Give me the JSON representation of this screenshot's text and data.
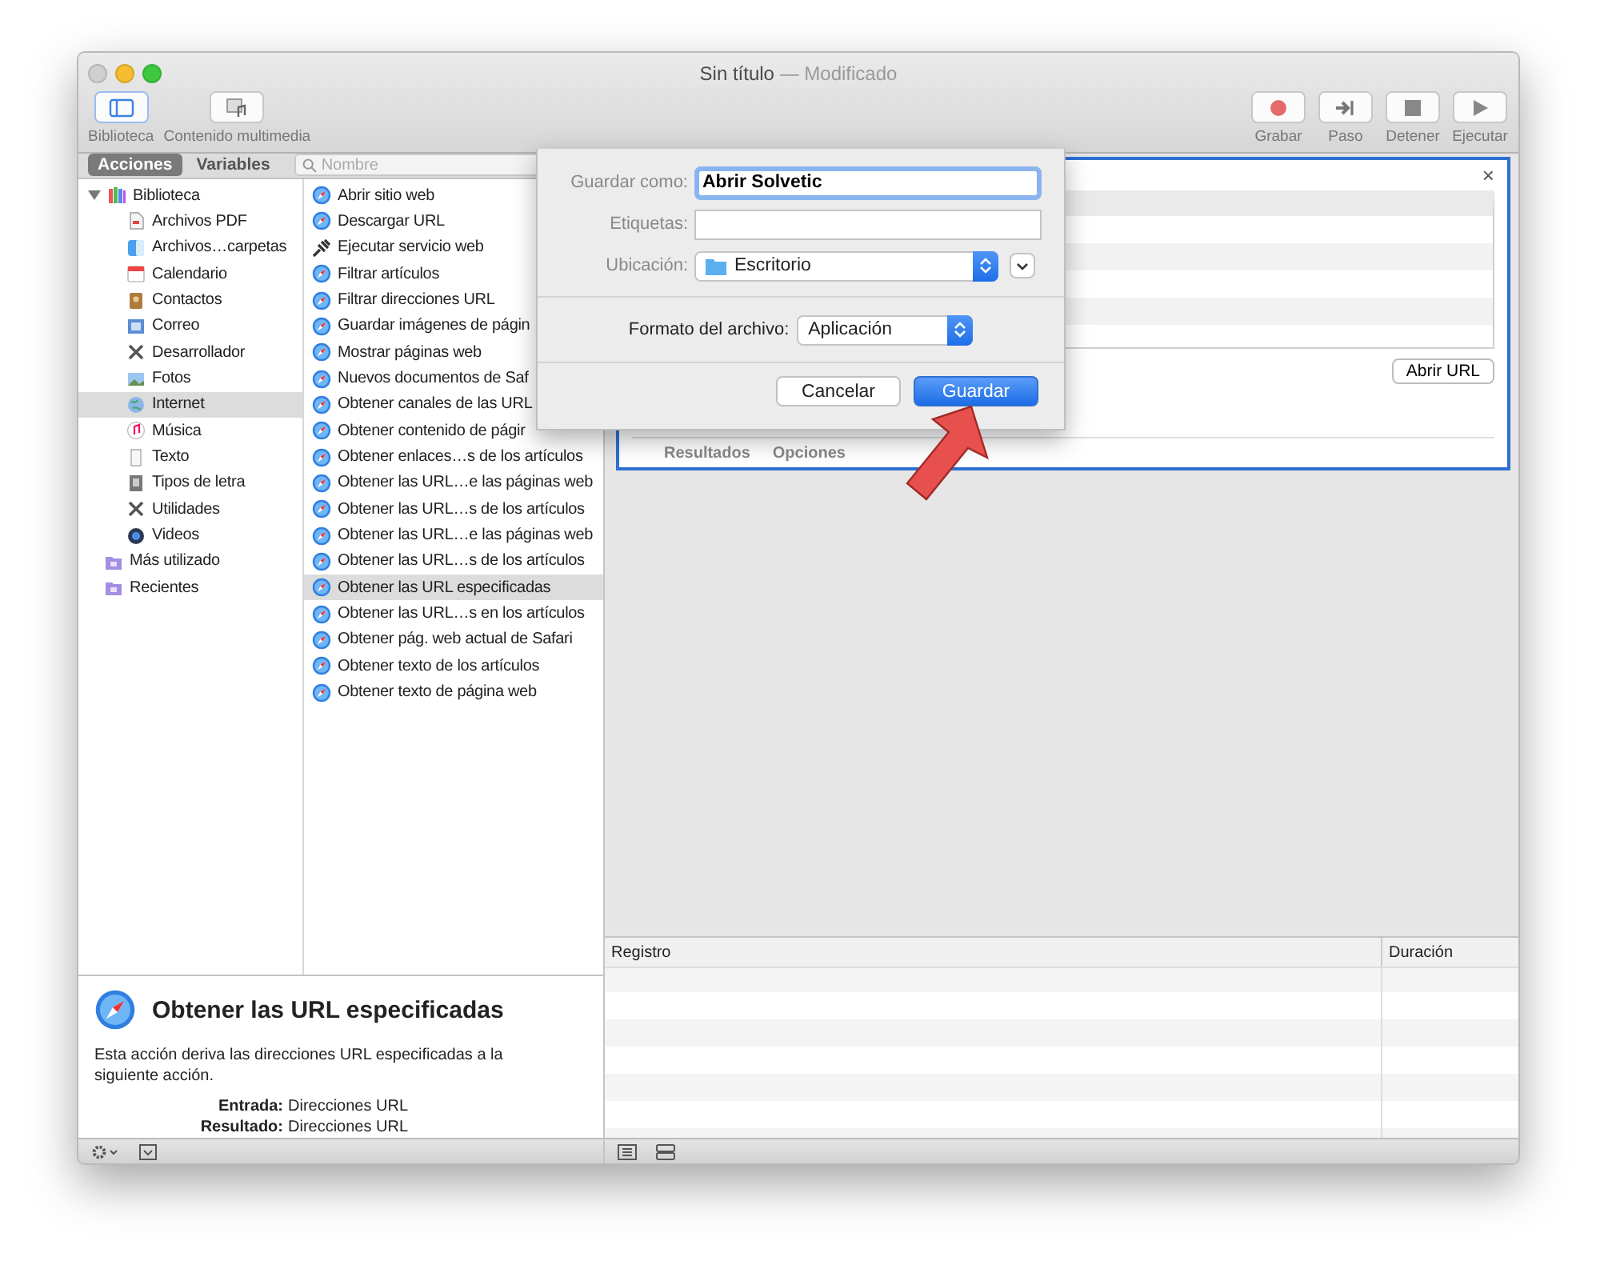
{
  "window": {
    "title": "Sin título",
    "subtitle": "— Modificado"
  },
  "toolbar": {
    "left": [
      {
        "label": "Biblioteca",
        "kind": "sidebar",
        "selected": true
      },
      {
        "label": "Contenido multimedia",
        "kind": "media",
        "selected": false
      }
    ],
    "right": [
      {
        "label": "Grabar",
        "kind": "record"
      },
      {
        "label": "Paso",
        "kind": "step"
      },
      {
        "label": "Detener",
        "kind": "stop"
      },
      {
        "label": "Ejecutar",
        "kind": "run"
      }
    ]
  },
  "panel_tabs": [
    {
      "label": "Acciones",
      "selected": true
    },
    {
      "label": "Variables",
      "selected": false
    }
  ],
  "search": {
    "placeholder": "Nombre"
  },
  "tree": [
    {
      "label": "Biblioteca",
      "kind": "library",
      "expanded": true,
      "selected": false,
      "children": [
        {
          "label": "Archivos PDF",
          "kind": "pdf",
          "selected": false
        },
        {
          "label": "Archivos…carpetas",
          "kind": "finder",
          "selected": false
        },
        {
          "label": "Calendario",
          "kind": "calendar",
          "selected": false
        },
        {
          "label": "Contactos",
          "kind": "contacts",
          "selected": false
        },
        {
          "label": "Correo",
          "kind": "mail",
          "selected": false
        },
        {
          "label": "Desarrollador",
          "kind": "tools",
          "selected": false
        },
        {
          "label": "Fotos",
          "kind": "photos",
          "selected": false
        },
        {
          "label": "Internet",
          "kind": "globe",
          "selected": true
        },
        {
          "label": "Música",
          "kind": "music",
          "selected": false
        },
        {
          "label": "Texto",
          "kind": "text",
          "selected": false
        },
        {
          "label": "Tipos de letra",
          "kind": "font",
          "selected": false
        },
        {
          "label": "Utilidades",
          "kind": "tools",
          "selected": false
        },
        {
          "label": "Videos",
          "kind": "video",
          "selected": false
        }
      ]
    },
    {
      "label": "Más utilizado",
      "kind": "folder",
      "selected": false
    },
    {
      "label": "Recientes",
      "kind": "folder",
      "selected": false
    }
  ],
  "actions": [
    {
      "label": "Abrir sitio web",
      "kind": "safari",
      "selected": false
    },
    {
      "label": "Descargar URL",
      "kind": "safari",
      "selected": false
    },
    {
      "label": "Ejecutar servicio web",
      "kind": "service",
      "selected": false
    },
    {
      "label": "Filtrar artículos",
      "kind": "safari",
      "selected": false
    },
    {
      "label": "Filtrar direcciones URL",
      "kind": "safari",
      "selected": false
    },
    {
      "label": "Guardar imágenes de págin",
      "kind": "safari",
      "selected": false
    },
    {
      "label": "Mostrar páginas web",
      "kind": "safari",
      "selected": false
    },
    {
      "label": "Nuevos documentos de Saf",
      "kind": "safari",
      "selected": false
    },
    {
      "label": "Obtener canales de las URL",
      "kind": "safari",
      "selected": false
    },
    {
      "label": "Obtener contenido de págir",
      "kind": "safari",
      "selected": false
    },
    {
      "label": "Obtener enlaces…s de los artículos",
      "kind": "safari",
      "selected": false
    },
    {
      "label": "Obtener las URL…e las páginas web",
      "kind": "safari",
      "selected": false
    },
    {
      "label": "Obtener las URL…s de los artículos",
      "kind": "safari",
      "selected": false
    },
    {
      "label": "Obtener las URL…e las páginas web",
      "kind": "safari",
      "selected": false
    },
    {
      "label": "Obtener las URL…s de los artículos",
      "kind": "safari",
      "selected": false
    },
    {
      "label": "Obtener las URL especificadas",
      "kind": "safari",
      "selected": true
    },
    {
      "label": "Obtener las URL…s en los artículos",
      "kind": "safari",
      "selected": false
    },
    {
      "label": "Obtener pág. web actual de Safari",
      "kind": "safari",
      "selected": false
    },
    {
      "label": "Obtener texto de los artículos",
      "kind": "safari",
      "selected": false
    },
    {
      "label": "Obtener texto de página web",
      "kind": "safari",
      "selected": false
    }
  ],
  "description": {
    "title": "Obtener las URL especificadas",
    "text": "Esta acción deriva las direcciones URL especificadas a la siguiente acción.",
    "fields": [
      {
        "label": "Entrada:",
        "value": "Direcciones URL"
      },
      {
        "label": "Resultado:",
        "value": "Direcciones URL"
      }
    ]
  },
  "action_card": {
    "close": "×",
    "button": "Abrir URL",
    "tabs": [
      "Resultados",
      "Opciones"
    ]
  },
  "log": {
    "columns": [
      "Registro",
      "Duración"
    ]
  },
  "save_dialog": {
    "save_as": {
      "label": "Guardar como:",
      "value": "Abrir Solvetic"
    },
    "tags": {
      "label": "Etiquetas:"
    },
    "location": {
      "label": "Ubicación:",
      "value": "Escritorio"
    },
    "format": {
      "label": "Formato del archivo:",
      "value": "Aplicación"
    },
    "buttons": [
      {
        "label": "Cancelar",
        "kind": "cancel"
      },
      {
        "label": "Guardar",
        "kind": "default"
      }
    ]
  }
}
